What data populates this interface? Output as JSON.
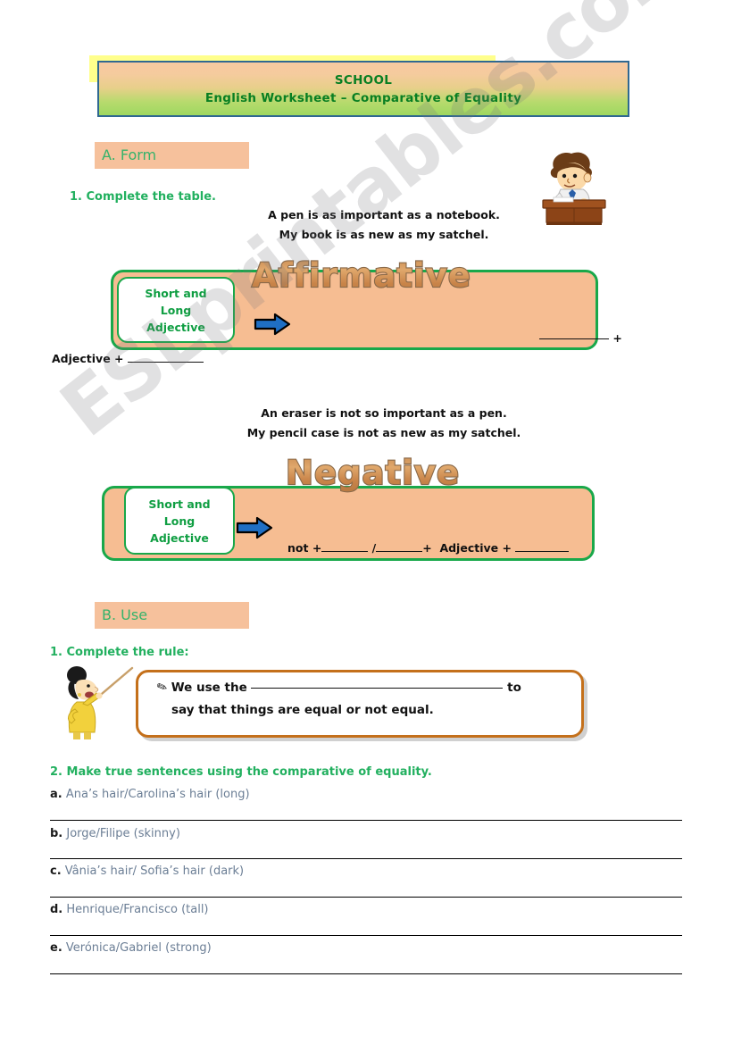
{
  "header": {
    "title": "SCHOOL",
    "subtitle": "English Worksheet – Comparative of Equality"
  },
  "watermark": "ESLprintables.com",
  "sections": {
    "a": {
      "heading": "A. Form"
    },
    "b": {
      "heading": "B. Use"
    }
  },
  "tasks": {
    "a1": "1.  Complete the table.",
    "b1": "1.  Complete the rule:",
    "b2": "2.  Make true sentences using the comparative of equality."
  },
  "affirmative": {
    "title": "Affirmative",
    "example_1": "A pen is as important as a notebook.",
    "example_2": "My book is as new as my satchel.",
    "inner_label_lines": [
      "Short and",
      "Long",
      "Adjective"
    ],
    "tail_plus": "+",
    "below_formula_prefix": "Adjective +"
  },
  "negative": {
    "title": "Negative",
    "example_1": "An eraser is not so important as a pen.",
    "example_2": "My pencil case is not as new as my satchel.",
    "inner_label_lines": [
      "Short and",
      "Long",
      "Adjective"
    ],
    "formula": {
      "not": "not +",
      "slash": "/",
      "plus1": "+",
      "adjective": "Adjective +"
    }
  },
  "rule": {
    "icon": "pencil-icon",
    "line_1_prefix": "We use the",
    "line_1_suffix": "to",
    "line_2": "say that things are equal or not equal."
  },
  "exercises": [
    {
      "letter": "a.",
      "text": "Ana’s hair/Carolina’s hair (long)"
    },
    {
      "letter": "b.",
      "text": "Jorge/Filipe (skinny)"
    },
    {
      "letter": "c.",
      "text": "Vânia’s hair/ Sofia’s hair (dark)"
    },
    {
      "letter": "d.",
      "text": "Henrique/Francisco (tall)"
    },
    {
      "letter": "e.",
      "text": "Verónica/Gabriel (strong)"
    }
  ],
  "colors": {
    "header_border": "#2f6891",
    "header_gradient_top": "#f7c9a0",
    "header_gradient_bottom": "#9ed860",
    "heading_green": "#087f22",
    "task_green": "#22b05f",
    "section_bg_peach": "#f6c19c",
    "box_fill_peach": "#f6bd92",
    "box_border_green": "#19a84a",
    "rule_border_brown": "#c4701b",
    "arrow_blue": "#1f6fc4",
    "exercise_text": "#6b7e95"
  },
  "clipart": {
    "boy": "boy-writing-at-desk",
    "teacher": "teacher-with-pointer"
  }
}
